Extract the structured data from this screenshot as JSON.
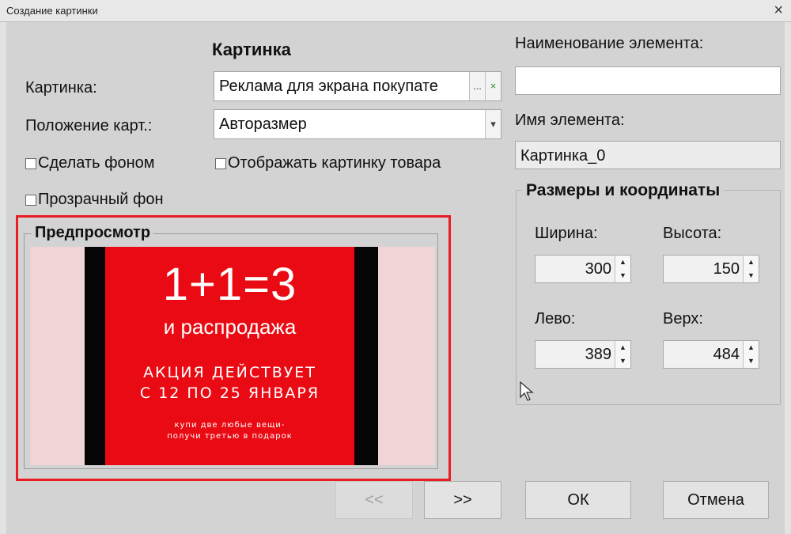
{
  "window": {
    "title": "Создание картинки",
    "close_glyph": "×"
  },
  "picture_section": {
    "heading": "Картинка",
    "picture_label": "Картинка:",
    "picture_value": "Реклама для экрана покупате",
    "browse_glyph": "...",
    "clear_glyph": "×",
    "position_label": "Положение карт.:",
    "position_value": "Авторазмер",
    "dropdown_glyph": "▾",
    "make_background": "Сделать фоном",
    "show_product_picture": "Отображать картинку товара",
    "transparent_background": "Прозрачный фон"
  },
  "preview": {
    "heading": "Предпросмотр",
    "ad": {
      "big": "1+1=3",
      "sub": "и распродажа",
      "promo_line1": "АКЦИЯ ДЕЙСТВУЕТ",
      "promo_line2": "С 12 ПО 25 ЯНВАРЯ",
      "small_line1": "купи две любые вещи-",
      "small_line2": "получи третью в подарок"
    },
    "prev_button": "<<",
    "next_button": ">>"
  },
  "element": {
    "name_label": "Наименование элемента:",
    "name_value": "",
    "id_label": "Имя элемента:",
    "id_value": "Картинка_0"
  },
  "coords": {
    "heading": "Размеры и координаты",
    "width_label": "Ширина:",
    "width_value": "300",
    "height_label": "Высота:",
    "height_value": "150",
    "left_label": "Лево:",
    "left_value": "389",
    "top_label": "Верх:",
    "top_value": "484",
    "up_glyph": "▲",
    "down_glyph": "▼"
  },
  "buttons": {
    "ok": "ОК",
    "cancel": "Отмена"
  },
  "colors": {
    "ad_red": "#ea0a13",
    "highlight": "#ea1c24",
    "dialog_bg": "#d3d3d3"
  }
}
